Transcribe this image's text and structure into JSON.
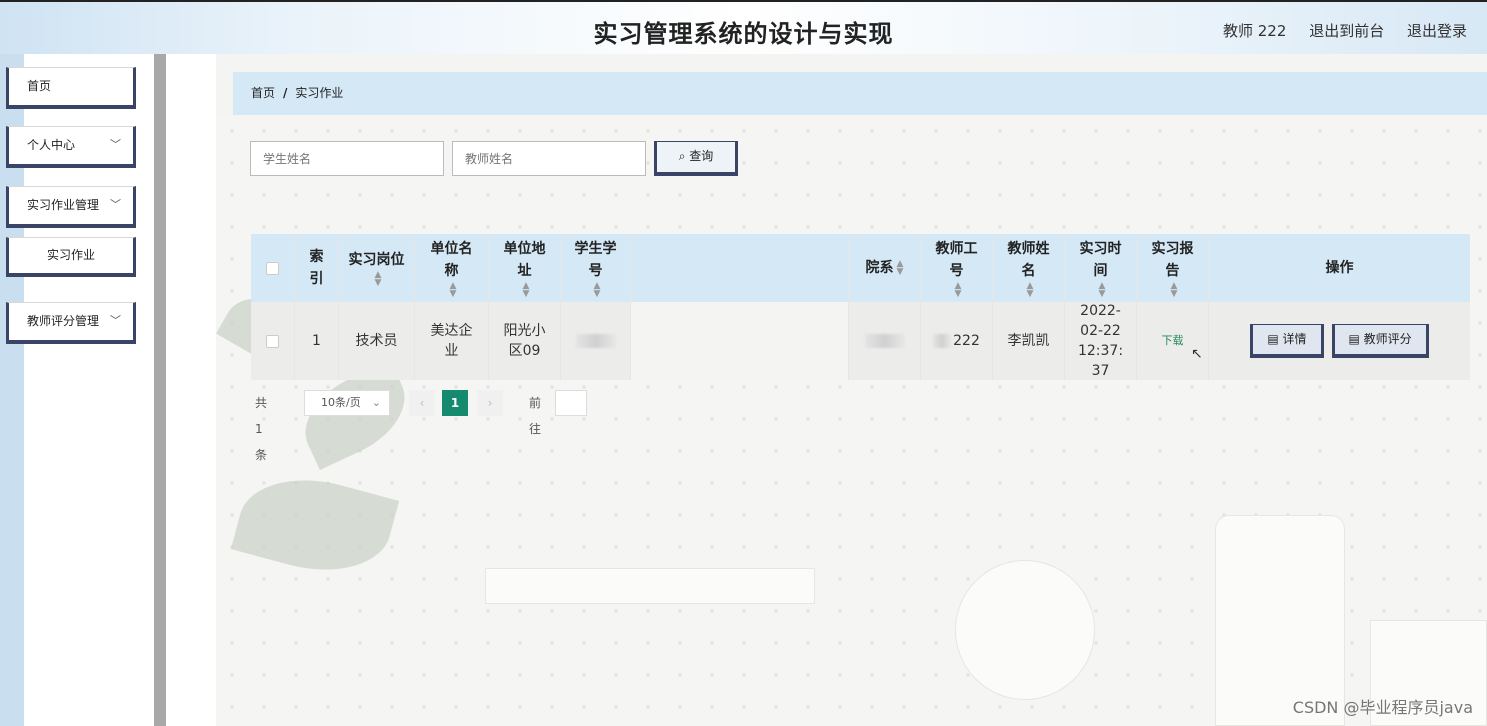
{
  "header": {
    "title": "实习管理系统的设计与实现",
    "user": "教师 222",
    "to_front": "退出到前台",
    "logout": "退出登录"
  },
  "sidebar": {
    "items": [
      {
        "label": "首页"
      },
      {
        "label": "个人中心",
        "chevron": "chevron-down-icon"
      },
      {
        "label": "实习作业管理",
        "chevron": "chevron-down-icon"
      },
      {
        "label": "实习作业"
      },
      {
        "label": "教师评分管理",
        "chevron": "chevron-down-icon"
      }
    ]
  },
  "breadcrumb": {
    "home": "首页",
    "separator": "/",
    "current": "实习作业"
  },
  "search": {
    "student_placeholder": "学生姓名",
    "teacher_placeholder": "教师姓名",
    "button_label": "查询"
  },
  "table": {
    "headers": {
      "index": "索引",
      "position": "实习岗位",
      "company": "单位名称",
      "address": "单位地址",
      "student_no": "学生学号",
      "department": "院系",
      "teacher_no": "教师工号",
      "teacher_name": "教师姓名",
      "time": "实习时间",
      "report": "实习报告",
      "ops": "操作"
    },
    "row": {
      "index": "1",
      "position": "技术员",
      "company": "美达企业",
      "address": "阳光小区09",
      "teacher_no": "222",
      "teacher_name": "李凯凯",
      "time": "2022-02-22 12:37:37",
      "report": "下载",
      "detail_label": "详情",
      "score_label": "教师评分"
    }
  },
  "pager": {
    "total": "共 1 条",
    "page_size": "10条/页",
    "current_page": "1",
    "goto": "前往"
  },
  "watermark": "CSDN @毕业程序员java",
  "colors": {
    "header_bg": "#eaf3fa",
    "table_header_bg": "#d4e8f6",
    "accent_border": "#3a4466",
    "page_active": "#158a6e",
    "download": "#2a8a5a"
  }
}
